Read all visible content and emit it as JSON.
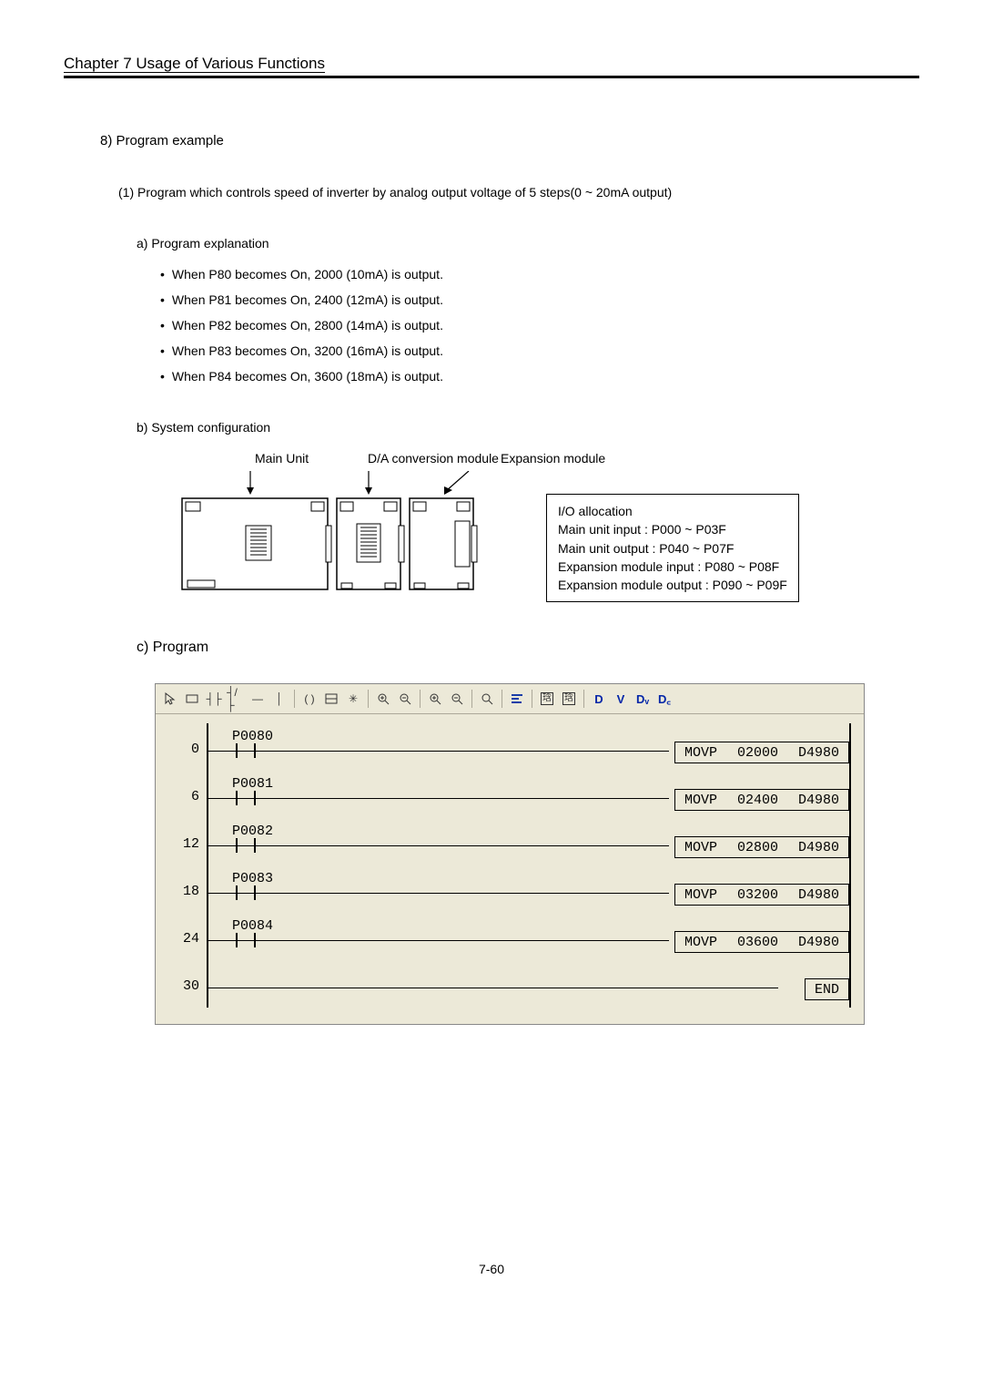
{
  "chapter_title": "Chapter 7    Usage of Various Functions",
  "section": "8) Program example",
  "sub1": "(1) Program which controls speed of inverter by analog output voltage of 5 steps(0 ~ 20mA output)",
  "a_heading": "a) Program explanation",
  "a_bullets": [
    "When P80 becomes On, 2000 (10mA) is output.",
    "When P81 becomes On, 2400 (12mA) is output.",
    "When P82 becomes On, 2800 (14mA) is output.",
    "When P83 becomes On, 3200 (16mA) is output.",
    "When P84 becomes On, 3600 (18mA) is output."
  ],
  "b_heading": "b) System configuration",
  "module_labels": {
    "main": "Main Unit",
    "da": "D/A conversion module",
    "exp": "Expansion module"
  },
  "io_box": [
    "I/O allocation",
    "Main unit input : P000 ~ P03F",
    "Main unit output : P040 ~ P07F",
    "Expansion module input : P080 ~ P08F",
    "Expansion module output : P090 ~ P09F"
  ],
  "c_heading": "c) Program",
  "toolbar": {
    "D": "D",
    "V": "V",
    "DV": "Dᵥ",
    "DC": "D꜀"
  },
  "ladder_rows": [
    {
      "num": "0",
      "contact": "P0080",
      "op": "MOVP",
      "val": "02000",
      "dst": "D4980"
    },
    {
      "num": "6",
      "contact": "P0081",
      "op": "MOVP",
      "val": "02400",
      "dst": "D4980"
    },
    {
      "num": "12",
      "contact": "P0082",
      "op": "MOVP",
      "val": "02800",
      "dst": "D4980"
    },
    {
      "num": "18",
      "contact": "P0083",
      "op": "MOVP",
      "val": "03200",
      "dst": "D4980"
    },
    {
      "num": "24",
      "contact": "P0084",
      "op": "MOVP",
      "val": "03600",
      "dst": "D4980"
    }
  ],
  "ladder_end": {
    "num": "30",
    "op": "END"
  },
  "page_num": "7-60"
}
